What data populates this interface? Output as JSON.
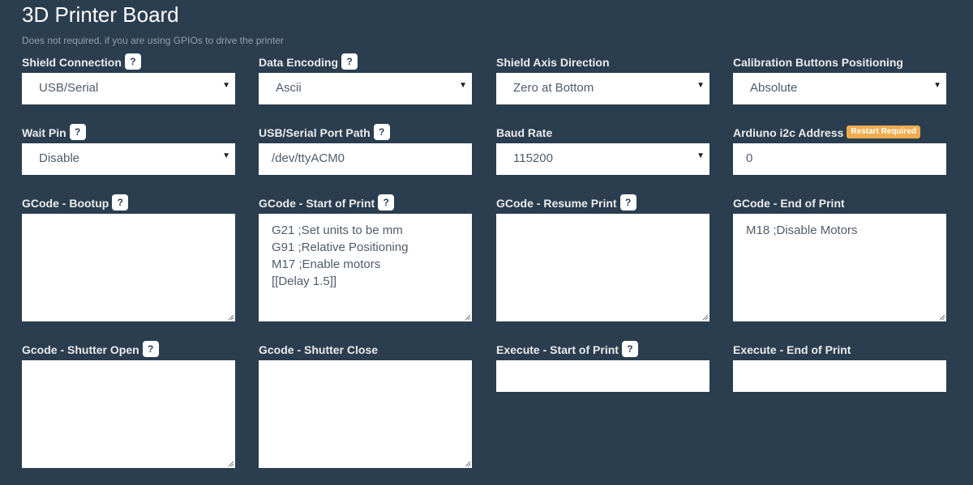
{
  "header": {
    "title": "3D Printer Board",
    "subtitle": "Does not required, if you are using GPIOs to drive the printer"
  },
  "help_glyph": "?",
  "restart_badge": "Restart Required",
  "fields": {
    "shield_connection": {
      "label": "Shield Connection",
      "value": "USB/Serial"
    },
    "data_encoding": {
      "label": "Data Encoding",
      "value": "Ascii"
    },
    "shield_axis_direction": {
      "label": "Shield Axis Direction",
      "value": "Zero at Bottom"
    },
    "calibration_buttons_positioning": {
      "label": "Calibration Buttons Positioning",
      "value": "Absolute"
    },
    "wait_pin": {
      "label": "Wait Pin",
      "value": "Disable"
    },
    "usb_serial_port_path": {
      "label": "USB/Serial Port Path",
      "value": "/dev/ttyACM0"
    },
    "baud_rate": {
      "label": "Baud Rate",
      "value": "115200"
    },
    "arduino_i2c_address": {
      "label": "Ardiuno i2c Address",
      "value": "0"
    },
    "gcode_bootup": {
      "label": "GCode - Bootup",
      "lines": []
    },
    "gcode_start_of_print": {
      "label": "GCode - Start of Print",
      "lines": [
        "G21 ;Set units to be mm",
        "G91 ;Relative Positioning",
        "M17 ;Enable motors",
        "[[Delay 1.5]]"
      ]
    },
    "gcode_resume_print": {
      "label": "GCode - Resume Print",
      "lines": []
    },
    "gcode_end_of_print": {
      "label": "GCode - End of Print",
      "lines": [
        "M18 ;Disable Motors"
      ]
    },
    "gcode_shutter_open": {
      "label": "Gcode - Shutter Open",
      "lines": []
    },
    "gcode_shutter_close": {
      "label": "Gcode - Shutter Close",
      "lines": []
    },
    "execute_start_of_print": {
      "label": "Execute - Start of Print",
      "value": ""
    },
    "execute_end_of_print": {
      "label": "Execute - End of Print",
      "value": ""
    }
  },
  "icons": {
    "dropdown": "caret-down-icon",
    "help": "help-icon",
    "resize": "resize-grip-icon"
  },
  "colors": {
    "background": "#2b3e50",
    "badge": "#f0ad4e",
    "field": "#ffffff"
  }
}
